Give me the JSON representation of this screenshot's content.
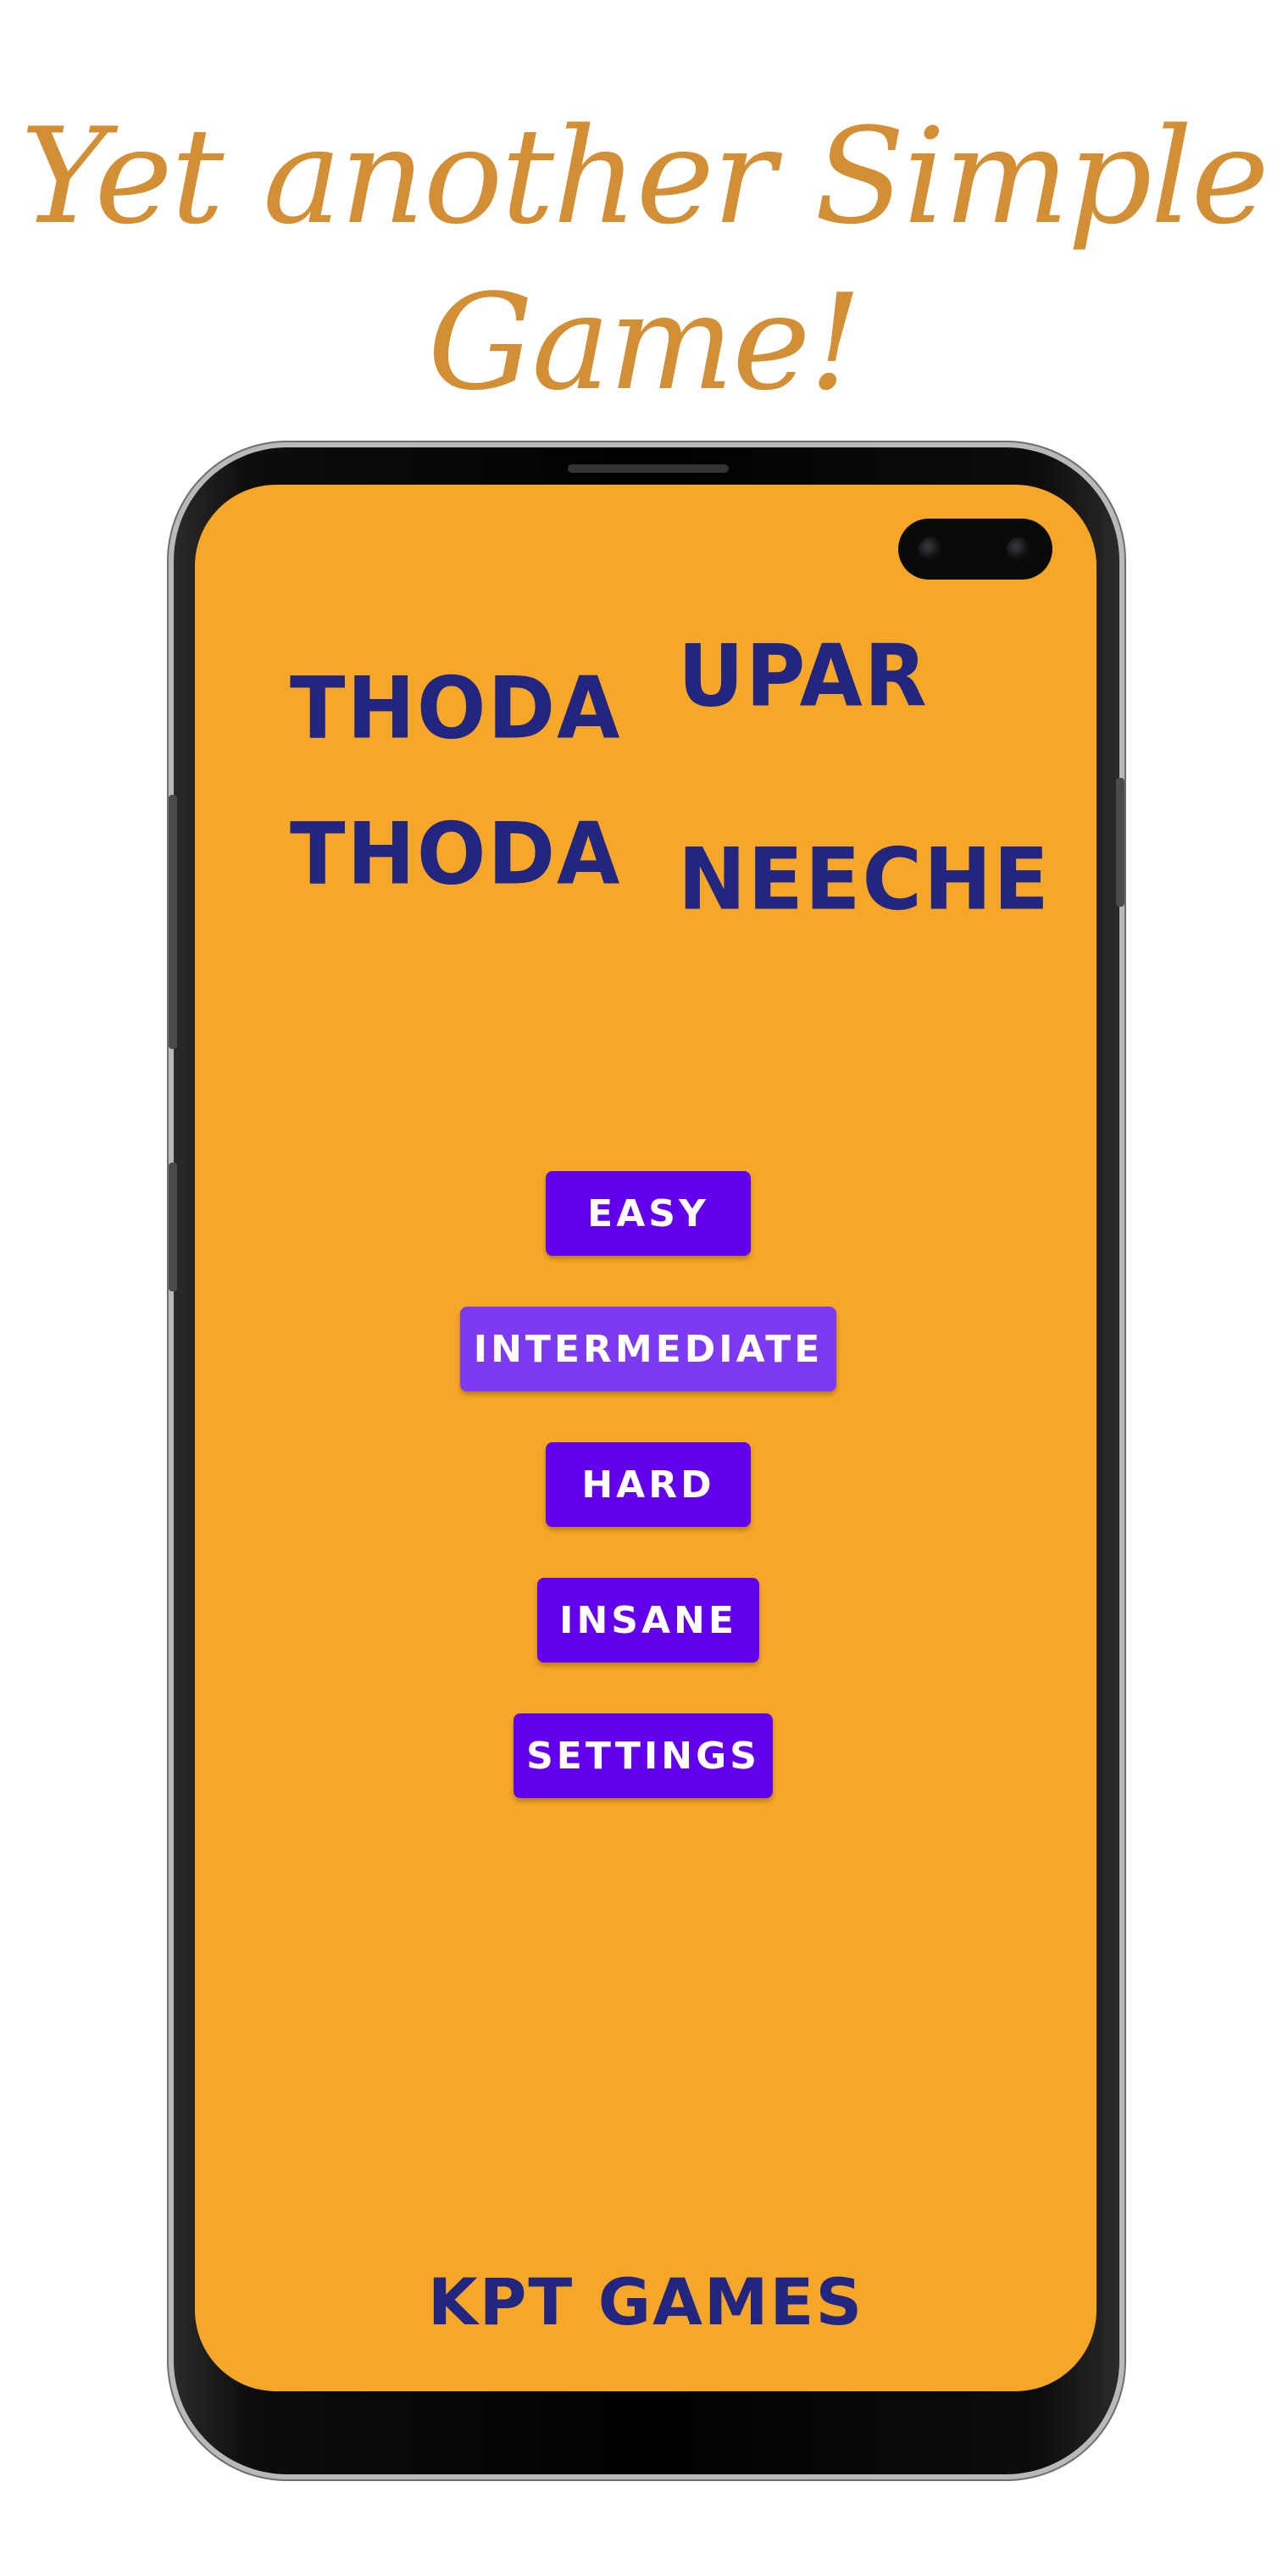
{
  "promo": {
    "title_line1": "Yet another Simple",
    "title_line2": "Game!"
  },
  "game_screen": {
    "words": {
      "left_top": "THODA",
      "left_bottom": "THODA",
      "right_top": "UPAR",
      "right_bottom": "NEECHE"
    },
    "menu": {
      "easy": "EASY",
      "intermediate": "INTERMEDIATE",
      "hard": "HARD",
      "insane": "INSANE",
      "settings": "SETTINGS"
    },
    "footer": "KPT GAMES"
  },
  "colors": {
    "title": "#d38f36",
    "screen_background": "#f7a727",
    "word_text": "#232680",
    "button": "#6200ee",
    "button_active": "#7e3af2",
    "button_text": "#ffffff"
  }
}
